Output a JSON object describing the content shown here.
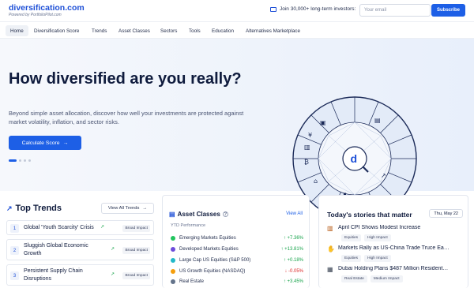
{
  "header": {
    "logo": "diversification.com",
    "logo_sub": "Powered by PortfolioPilot.com",
    "join_text": "Join 30,000+ long-term investors:",
    "email_placeholder": "Your email",
    "subscribe_label": "Subscribe"
  },
  "nav": {
    "items": [
      {
        "label": "Home"
      },
      {
        "label": "Diversification Score"
      },
      {
        "label": "Trends"
      },
      {
        "label": "Asset Classes"
      },
      {
        "label": "Sectors"
      },
      {
        "label": "Tools"
      },
      {
        "label": "Education"
      },
      {
        "label": "Alternatives Marketplace"
      }
    ]
  },
  "hero": {
    "title": "How diversified are you really?",
    "description": "Beyond simple asset allocation, discover how well your investments are protected against market volatility, inflation, and sector risks.",
    "cta_label": "Calculate Score",
    "wheel_center_letter": "d"
  },
  "trends": {
    "title": "Top Trends",
    "view_all": "View All Trends",
    "items": [
      {
        "num": "1",
        "text": "Global 'Youth Scarcity' Crisis",
        "badge": "Broad Impact"
      },
      {
        "num": "2",
        "text": "Sluggish Global Economic Growth",
        "badge": "Broad Impact"
      },
      {
        "num": "3",
        "text": "Persistent Supply Chain Disruptions",
        "badge": "Broad Impact"
      }
    ]
  },
  "assets": {
    "title": "Asset Classes",
    "view_all": "View All",
    "subtitle": "YTD Performance",
    "items": [
      {
        "name": "Emerging Markets Equities",
        "value": "↑ +7.36%",
        "color": "#22c55e",
        "value_color": "#16a34a"
      },
      {
        "name": "Developed Markets Equities",
        "value": "↑ +13.81%",
        "color": "#6d4cdb",
        "value_color": "#16a34a"
      },
      {
        "name": "Large Cap US Equities (S&P 500)",
        "value": "↑ +0.18%",
        "color": "#22b8c8",
        "value_color": "#16a34a"
      },
      {
        "name": "US Growth Equities (NASDAQ)",
        "value": "↓ -0.05%",
        "color": "#f59e0b",
        "value_color": "#dc2626"
      },
      {
        "name": "Real Estate",
        "value": "↑ +3.45%",
        "color": "#64748b",
        "value_color": "#16a34a"
      }
    ]
  },
  "stories": {
    "title": "Today's stories that matter",
    "date": "Thu, May 22",
    "items": [
      {
        "headline": "April CPI Shows Modest Increase",
        "tags": [
          "Equities",
          "High Impact"
        ]
      },
      {
        "headline": "Markets Rally as US-China Trade Truce Ea…",
        "tags": [
          "Equities",
          "High Impact"
        ]
      },
      {
        "headline": "Dubai Holding Plans $487 Million Resident…",
        "tags": [
          "Real Estate",
          "Medium Impact"
        ]
      }
    ]
  }
}
